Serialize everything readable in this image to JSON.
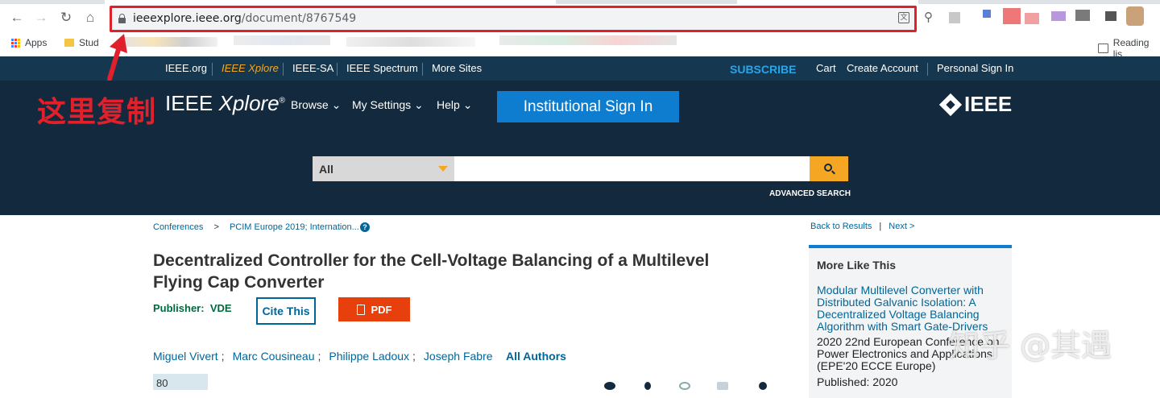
{
  "browser": {
    "url_host": "ieeexplore.ieee.org",
    "url_path": "/document/8767549",
    "bookmarks": [
      {
        "label": "Apps",
        "icon": "apps-grid-icon"
      },
      {
        "label": "Stud",
        "icon": "folder-icon"
      }
    ],
    "reading_list_label": "Reading lis"
  },
  "annotation": {
    "text": "这里复制",
    "color": "#e0202a"
  },
  "topbar": {
    "links": [
      "IEEE.org",
      "IEEE Xplore",
      "IEEE-SA",
      "IEEE Spectrum",
      "More Sites"
    ],
    "subscribe": "SUBSCRIBE",
    "cart": "Cart",
    "create_account": "Create Account",
    "personal_sign_in": "Personal Sign In"
  },
  "header": {
    "logo_main": "IEEE",
    "logo_italic": "Xplore",
    "logo_reg": "®",
    "menu": [
      "Browse",
      "My Settings",
      "Help"
    ],
    "institutional_sign_in": "Institutional Sign In",
    "brand_logo": "IEEE",
    "search": {
      "scope": "All",
      "value": "",
      "advanced": "ADVANCED SEARCH"
    }
  },
  "breadcrumb": {
    "items": [
      "Conferences",
      ">",
      "PCIM Europe 2019; Internation..."
    ]
  },
  "document": {
    "title": "Decentralized Controller for the Cell-Voltage Balancing of a Multilevel Flying Cap Converter",
    "publisher_label": "Publisher:",
    "publisher": "VDE",
    "cite_button": "Cite This",
    "pdf_button": "PDF",
    "authors": [
      "Miguel Vivert",
      "Marc Cousineau",
      "Philippe Ladoux",
      "Joseph Fabre"
    ],
    "all_authors": "All Authors",
    "metric": "80"
  },
  "results_nav": {
    "back": "Back to Results",
    "next": "Next >"
  },
  "more_like_this": {
    "heading": "More Like This",
    "link": "Modular Multilevel Converter with Distributed Galvanic Isolation: A Decentralized Voltage Balancing Algorithm with Smart Gate-Drivers",
    "venue": "2020 22nd European Conference on Power Electronics and Applications (EPE'20 ECCE Europe)",
    "published": "Published: 2020"
  },
  "watermark": "知乎 @其遇",
  "colors": {
    "topbar": "#15374f",
    "header": "#13293d",
    "accent_orange": "#f5a623",
    "sign_in_blue": "#0e7dcf",
    "pdf_red": "#e8400c",
    "link_blue": "#006699"
  }
}
